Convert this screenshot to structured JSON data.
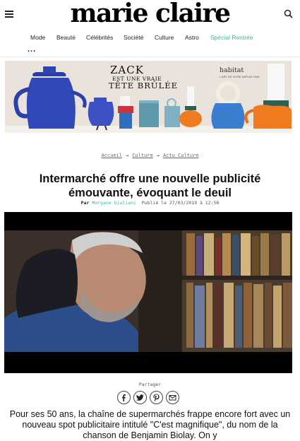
{
  "header": {
    "logo": "marie claire",
    "nav": [
      "Mode",
      "Beauté",
      "Célébrités",
      "Société",
      "Culture",
      "Astro",
      "Spécial Rentrée"
    ],
    "more": "..."
  },
  "ad": {
    "headline": "ZACK",
    "sub1": "EST UNE VRAIE",
    "sub2": "TÊTE BRÛLÉE",
    "brand": "habitat",
    "tagline": "L'ART DE VIVRE DEPUIS 1964"
  },
  "article": {
    "breadcrumb": [
      "Accueil",
      "Culture",
      "Actu Culture"
    ],
    "breadcrumb_sep": "→",
    "title": "Intermarché offre une nouvelle publicité émouvante, évoquant le deuil",
    "by": "Par",
    "author": "Morgane Giuliani",
    "published": "Publié le 27/03/2019 à 12:58",
    "share_label": "Partager",
    "share_buttons": [
      "facebook-icon",
      "twitter-icon",
      "pinterest-icon",
      "mail-icon"
    ],
    "lead": "Pour ses 50 ans, la chaîne de supermarchés frappe encore fort avec un nouveau spot publicitaire intitulé \"C'est magnifique\", du nom de la chanson de Benjamin Biolay. On y"
  },
  "colors": {
    "accent": "#3fb3a0",
    "text": "#111111",
    "ad_bg": "#e9e3dc"
  }
}
